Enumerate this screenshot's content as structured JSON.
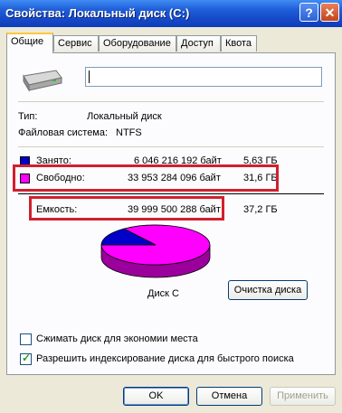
{
  "window": {
    "title": "Свойства: Локальный диск (C:)",
    "help_label": "?",
    "close_label": "✕"
  },
  "tabs": [
    {
      "label": "Общие"
    },
    {
      "label": "Сервис"
    },
    {
      "label": "Оборудование"
    },
    {
      "label": "Доступ"
    },
    {
      "label": "Квота"
    }
  ],
  "general": {
    "disk_name_value": "",
    "type_label": "Тип:",
    "type_value": "Локальный диск",
    "fs_label": "Файловая система:",
    "fs_value": "NTFS"
  },
  "usage": {
    "used": {
      "label": "Занято:",
      "bytes": "6 046 216 192 байт",
      "size": "5,63 ГБ",
      "color": "#0000c8"
    },
    "free": {
      "label": "Свободно:",
      "bytes": "33 953 284 096 байт",
      "size": "31,6 ГБ",
      "color": "#ff00ff"
    },
    "capacity": {
      "label": "Емкость:",
      "bytes": "39 999 500 288 байт",
      "size": "37,2 ГБ"
    },
    "used_fraction": 0.151
  },
  "chart_caption": "Диск C",
  "cleanup_button": "Очистка диска",
  "options": {
    "compress": {
      "label": "Сжимать диск для экономии места",
      "checked": false
    },
    "index": {
      "label": "Разрешить индексирование диска для быстрого поиска",
      "checked": true
    }
  },
  "buttons": {
    "ok": "OK",
    "cancel": "Отмена",
    "apply": "Применить"
  }
}
